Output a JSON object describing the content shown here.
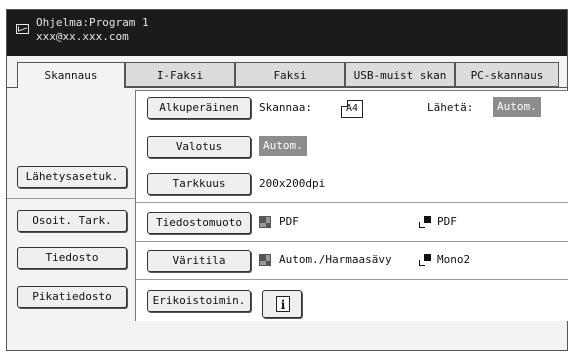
{
  "header": {
    "program": "Ohjelma:Program 1",
    "email": "xxx@xx.xxx.com"
  },
  "tabs": [
    {
      "label": "Skannaus",
      "active": true
    },
    {
      "label": "I-Faksi",
      "active": false
    },
    {
      "label": "Faksi",
      "active": false
    },
    {
      "label": "USB-muist skan",
      "active": false
    },
    {
      "label": "PC-skannaus",
      "active": false
    }
  ],
  "left_buttons": {
    "send_settings": "Lähetysasetuk.",
    "address_check": "Osoit. Tark.",
    "file": "Tiedosto",
    "quick_file": "Pikatiedosto"
  },
  "settings": {
    "original": {
      "button": "Alkuperäinen",
      "scan_label": "Skannaa:",
      "scan_size": "A4",
      "send_label": "Lähetä:",
      "send_value": "Autom."
    },
    "exposure": {
      "button": "Valotus",
      "value": "Autom."
    },
    "resolution": {
      "button": "Tarkkuus",
      "value": "200x200dpi"
    },
    "file_format": {
      "button": "Tiedostomuoto",
      "color_value": "PDF",
      "mono_value": "PDF"
    },
    "color_mode": {
      "button": "Väritila",
      "color_value": "Autom./Harmaasävy",
      "mono_value": "Mono2"
    },
    "special": {
      "button": "Erikoistoimin."
    }
  },
  "icons": [
    "mail-icon",
    "paper-a4-icon",
    "color-grid-icon",
    "mono-icon",
    "info-icon"
  ]
}
